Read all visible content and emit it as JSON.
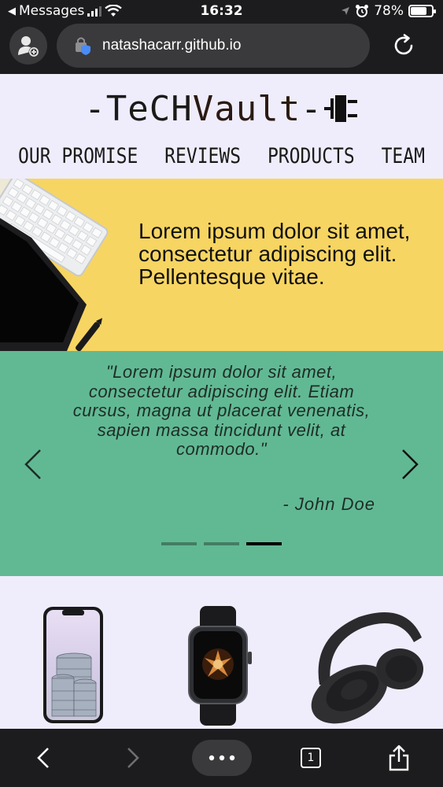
{
  "status_bar": {
    "back_app": "Messages",
    "time": "16:32",
    "battery_percent": "78%",
    "battery_level": 0.78
  },
  "browser": {
    "url": "natashacarr.github.io",
    "tab_count": "1"
  },
  "site": {
    "logo": {
      "prefix": "-TeCH",
      "middle": "Vault",
      "suffix": "-"
    },
    "nav": [
      "OUR PROMISE",
      "REVIEWS",
      "PRODUCTS",
      "TEAM"
    ],
    "hero_text": "Lorem ipsum dolor sit amet, consectetur adipiscing elit. Pellentesque vitae.",
    "testimonial": {
      "quote": "\"Lorem ipsum dolor sit amet, consectetur adipiscing elit. Etiam cursus, magna ut placerat venenatis, sapien massa tincidunt velit, at commodo.\"",
      "author": "- John Doe",
      "slide_count": 3,
      "active_slide": 3
    }
  },
  "colors": {
    "page_bg": "#efedfb",
    "hero_bg": "#f7d562",
    "testimonial_bg": "#61b994",
    "chrome_bg": "#1c1c1e"
  }
}
